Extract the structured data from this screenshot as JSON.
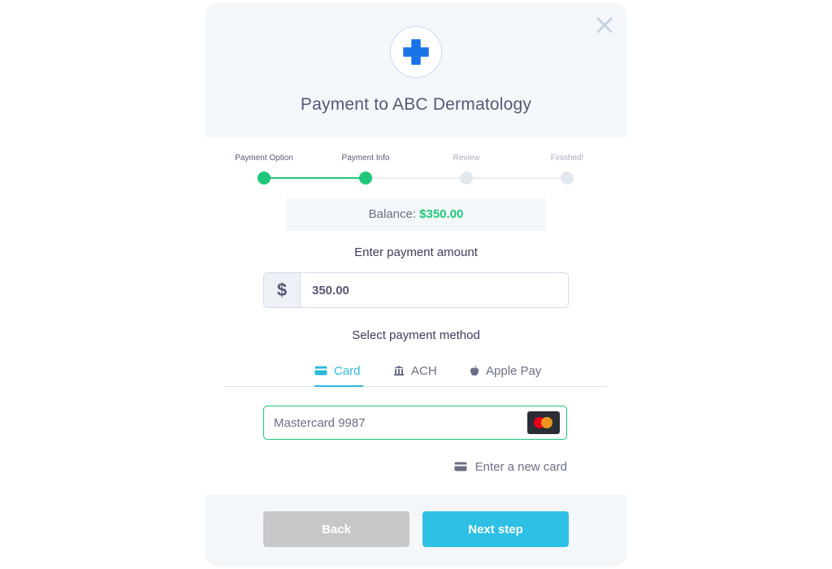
{
  "modal": {
    "title": "Payment to ABC Dermatology",
    "logo_icon": "medical-cross-icon",
    "close_icon": "close-icon"
  },
  "stepper": {
    "steps": [
      {
        "label": "Payment Option",
        "state": "complete"
      },
      {
        "label": "Payment Info",
        "state": "current"
      },
      {
        "label": "Review",
        "state": "upcoming"
      },
      {
        "label": "Finished!",
        "state": "upcoming"
      }
    ]
  },
  "balance": {
    "label": "Balance:",
    "amount": "$350.00"
  },
  "amount": {
    "heading": "Enter payment amount",
    "currency_symbol": "$",
    "value": "350.00"
  },
  "method": {
    "heading": "Select payment method",
    "tabs": [
      {
        "label": "Card",
        "icon": "card-icon",
        "active": true
      },
      {
        "label": "ACH",
        "icon": "bank-icon",
        "active": false
      },
      {
        "label": "Apple Pay",
        "icon": "apple-icon",
        "active": false
      }
    ],
    "saved_card": {
      "label": "Mastercard 9987",
      "brand_icon": "mastercard-icon"
    },
    "new_card_label": "Enter a new card"
  },
  "footer": {
    "back_label": "Back",
    "next_label": "Next step"
  },
  "colors": {
    "accent": "#2ec0e4",
    "success": "#1fc77a",
    "logo_blue": "#1a73e8"
  }
}
